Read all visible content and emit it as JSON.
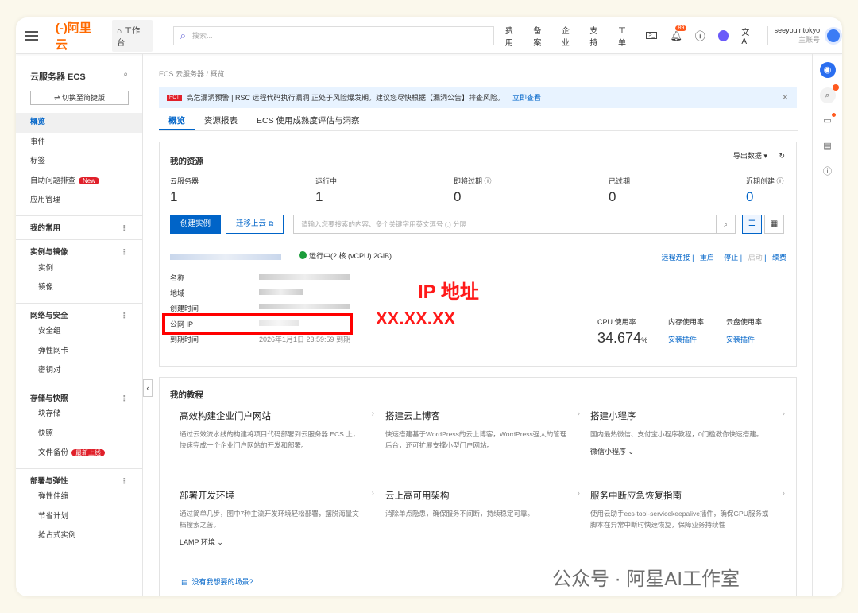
{
  "header": {
    "logo": "(-)阿里云",
    "workbench": "工作台",
    "search_placeholder": "搜索...",
    "nav": [
      "费用",
      "备案",
      "企业",
      "支持",
      "工单"
    ],
    "notif_count": "89",
    "username": "seeyouintokyo",
    "account_type": "主账号"
  },
  "sidebar": {
    "title": "云服务器 ECS",
    "switch": "⇌ 切换至简捷版",
    "items": [
      {
        "label": "概览",
        "type": "active"
      },
      {
        "label": "事件"
      },
      {
        "label": "标签"
      },
      {
        "label": "自助问题排查",
        "tag": "New"
      },
      {
        "label": "应用管理"
      },
      {
        "label": "我的常用",
        "type": "sec"
      },
      {
        "label": "实例与镜像",
        "type": "sec"
      },
      {
        "label": "实例",
        "type": "sub"
      },
      {
        "label": "镜像",
        "type": "sub"
      },
      {
        "label": "网络与安全",
        "type": "sec"
      },
      {
        "label": "安全组",
        "type": "sub"
      },
      {
        "label": "弹性网卡",
        "type": "sub"
      },
      {
        "label": "密钥对",
        "type": "sub"
      },
      {
        "label": "存储与快照",
        "type": "sec"
      },
      {
        "label": "块存储",
        "type": "sub"
      },
      {
        "label": "快照",
        "type": "sub"
      },
      {
        "label": "文件备份",
        "type": "sub",
        "tag": "最新上线"
      },
      {
        "label": "部署与弹性",
        "type": "sec"
      },
      {
        "label": "弹性伸缩",
        "type": "sub"
      },
      {
        "label": "节省计划",
        "type": "sub"
      },
      {
        "label": "抢占式实例",
        "type": "sub"
      }
    ]
  },
  "breadcrumb": "ECS 云服务器  /  概览",
  "alert": {
    "hot": "HOT",
    "text": "高危漏洞预警 | RSC 远程代码执行漏洞 正处于风险爆发期。建议您尽快根据【漏洞公告】排查风险。",
    "link": "立即查看"
  },
  "tabs": [
    "概览",
    "资源报表",
    "ECS 使用成熟度评估与洞察"
  ],
  "resources": {
    "title": "我的资源",
    "export": "导出数据 ▾",
    "stats": [
      {
        "label": "云服务器",
        "value": "1"
      },
      {
        "label": "运行中",
        "value": "1"
      },
      {
        "label": "即将过期 ⓘ",
        "value": "0"
      },
      {
        "label": "已过期",
        "value": "0"
      },
      {
        "label": "近期创建 ⓘ",
        "value": "0"
      }
    ],
    "create": "创建实例",
    "migrate": "迁移上云 ⧉",
    "search_placeholder": "请输入您要搜索的内容、多个关键字用英文逗号 (,) 分隔",
    "instance": {
      "status": "运行中(2 核 (vCPU) 2GiB)",
      "actions": [
        "远程连接",
        "重启",
        "停止",
        "启动",
        "续费"
      ],
      "fields": [
        "名称",
        "地域",
        "创建时间",
        "公网 IP",
        "到期时间"
      ],
      "expire": "2026年1月1日 23:59:59  到期",
      "cpu_label": "CPU 使用率",
      "cpu_value": "34.674",
      "cpu_unit": "%",
      "mem_label": "内存使用率",
      "disk_label": "云盘使用率",
      "install": "安装插件"
    },
    "annotation_title": "IP 地址",
    "annotation_ip": "XX.XX.XX"
  },
  "tutorials": {
    "title": "我的教程",
    "cards": [
      {
        "title": "高效构建企业门户网站",
        "desc": "通过云效流水线的构建将项目代码部署到云服务器 ECS 上，快速完成一个企业门户网站的开发和部署。"
      },
      {
        "title": "搭建云上博客",
        "desc": "快速搭建基于WordPress的云上博客，WordPress强大的管理后台，还可扩展支撑小型门户网站。"
      },
      {
        "title": "搭建小程序",
        "desc": "国内最热微信、支付宝小程序教程，0门槛教你快速搭建。",
        "more": "微信小程序 ⌄"
      },
      {
        "title": "部署开发环境",
        "desc": "通过简单几步，图中7种主流开发环境轻松部署，摆脱海量文档搜索之苦。",
        "more": "LAMP 环境 ⌄"
      },
      {
        "title": "云上高可用架构",
        "desc": "消除单点隐患，确保服务不间断，持续稳定可靠。"
      },
      {
        "title": "服务中断应急恢复指南",
        "desc": "使用云助手ecs-tool-servicekeepalive插件，确保GPU服务或脚本在异常中断时快速恢复，保障业务持续性"
      }
    ],
    "feedback": "没有我想要的场景?"
  },
  "watermark": "公众号 · 阿星AI工作室"
}
